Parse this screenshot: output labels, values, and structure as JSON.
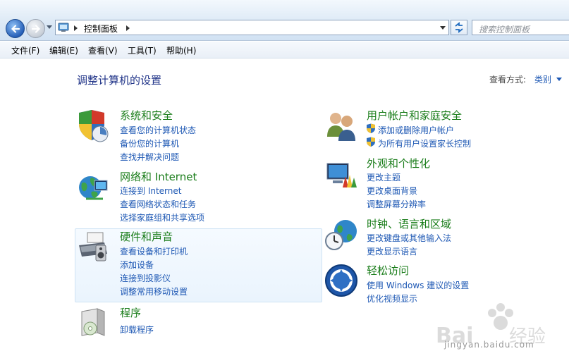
{
  "address_bar": {
    "path_label": "控制面板",
    "search_placeholder": "搜索控制面板"
  },
  "menu": [
    "文件(F)",
    "编辑(E)",
    "查看(V)",
    "工具(T)",
    "帮助(H)"
  ],
  "page_title": "调整计算机的设置",
  "view_by": {
    "label": "查看方式:",
    "value": "类别"
  },
  "left_categories": [
    {
      "title": "系统和安全",
      "links": [
        "查看您的计算机状态",
        "备份您的计算机",
        "查找并解决问题"
      ]
    },
    {
      "title": "网络和 Internet",
      "links": [
        "连接到 Internet",
        "查看网络状态和任务",
        "选择家庭组和共享选项"
      ]
    },
    {
      "title": "硬件和声音",
      "links": [
        "查看设备和打印机",
        "添加设备",
        "连接到投影仪",
        "调整常用移动设置"
      ]
    },
    {
      "title": "程序",
      "links": [
        "卸载程序"
      ]
    }
  ],
  "right_categories": [
    {
      "title": "用户帐户和家庭安全",
      "links": [
        "添加或删除用户帐户",
        "为所有用户设置家长控制"
      ]
    },
    {
      "title": "外观和个性化",
      "links": [
        "更改主题",
        "更改桌面背景",
        "调整屏幕分辨率"
      ]
    },
    {
      "title": "时钟、语言和区域",
      "links": [
        "更改键盘或其他输入法",
        "更改显示语言"
      ]
    },
    {
      "title": "轻松访问",
      "links": [
        "使用 Windows 建议的设置",
        "优化视频显示"
      ]
    }
  ],
  "watermark": {
    "brand": "Baidu经验",
    "url": "jingyan.baidu.com"
  },
  "colors": {
    "category_title": "#1a7d1a",
    "link": "#1e58b4",
    "page_title": "#1e3287"
  }
}
